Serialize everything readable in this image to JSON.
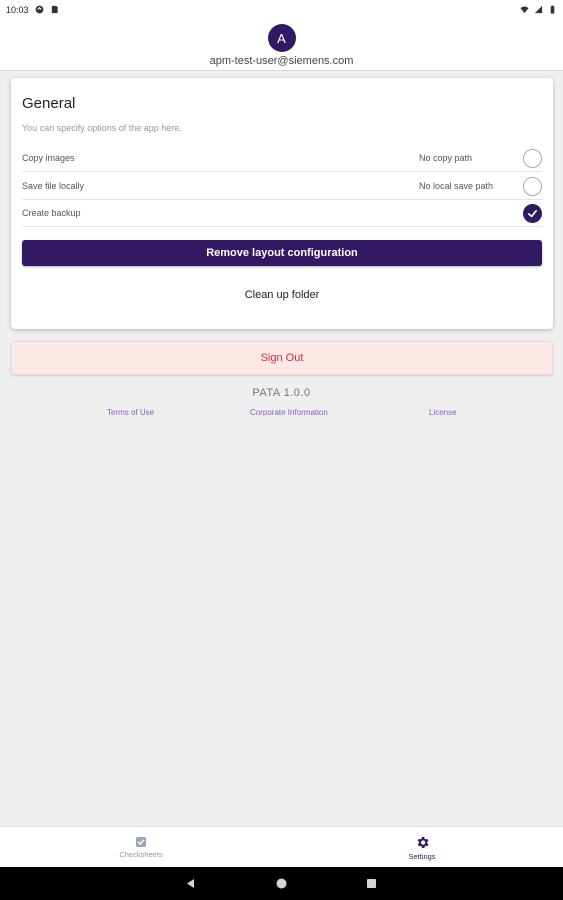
{
  "status_bar": {
    "time": "10:03"
  },
  "header": {
    "avatar_initial": "A",
    "user_email": "apm-test-user@siemens.com"
  },
  "settings_card": {
    "title": "General",
    "description": "You can specify options of the app here.",
    "options": [
      {
        "label": "Copy images",
        "value": "No copy path",
        "checked": false
      },
      {
        "label": "Save file locally",
        "value": "No local save path",
        "checked": false
      },
      {
        "label": "Create backup",
        "value": "",
        "checked": true
      }
    ],
    "remove_layout_label": "Remove layout configuration",
    "clean_up_label": "Clean up folder"
  },
  "sign_out_label": "Sign Out",
  "version": "PATA 1.0.0",
  "footer_links": {
    "terms": "Terms of Use",
    "corporate": "Corporate Information",
    "license": "License"
  },
  "bottom_nav": {
    "checksheets_label": "Checksheets",
    "settings_label": "Settings",
    "active": "Settings",
    "checksheets_icon": "checksheet-icon",
    "settings_icon": "gear-icon"
  },
  "colors": {
    "accent": "#311a63",
    "sign_out_text": "#d03030",
    "sign_out_bg": "#fde8e8",
    "link": "#8a5cc0"
  }
}
